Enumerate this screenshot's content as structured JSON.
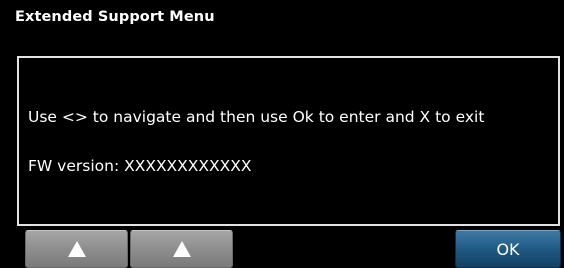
{
  "header": {
    "title": "Extended Support Menu"
  },
  "panel": {
    "instruction": "Use <> to navigate and then use Ok to enter and X to exit",
    "firmware_version": "FW version: XXXXXXXXXXXX"
  },
  "softkeys": {
    "left_icon": "up-arrow-icon",
    "right_icon": "up-arrow-icon",
    "ok_label": "OK"
  },
  "colors": {
    "background": "#000000",
    "text": "#ffffff",
    "panel_border": "#e2e2e2",
    "softkey_gray": "#8e8e8e",
    "ok_blue": "#1f5a84"
  }
}
